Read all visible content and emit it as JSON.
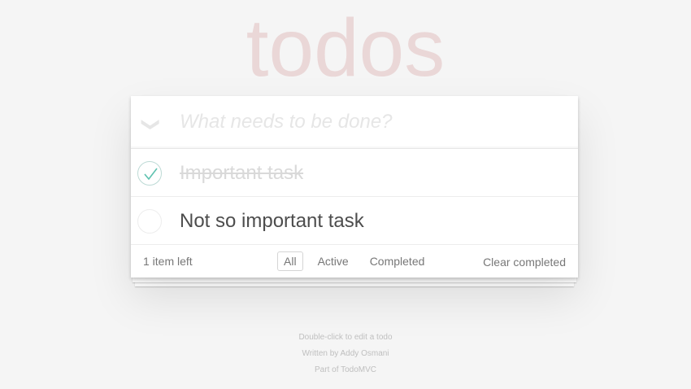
{
  "app": {
    "title": "todos"
  },
  "header": {
    "toggle_all_icon": "chevron-down-icon",
    "new_todo_placeholder": "What needs to be done?",
    "new_todo_value": ""
  },
  "todos": [
    {
      "label": "Important task",
      "completed": true
    },
    {
      "label": "Not so important task",
      "completed": false
    }
  ],
  "footer": {
    "count_text": "1 item left",
    "filters": [
      "All",
      "Active",
      "Completed"
    ],
    "selected_filter": "All",
    "clear_completed": "Clear completed"
  },
  "info": {
    "line1": "Double-click to edit a todo",
    "line2": "Written by Addy Osmani",
    "line3": "Part of TodoMVC"
  },
  "colors": {
    "background": "#f5f5f5",
    "title": "rgba(175,47,47,0.15)",
    "checkmark": "#5dc2af",
    "completed_text": "#d9d9d9"
  }
}
